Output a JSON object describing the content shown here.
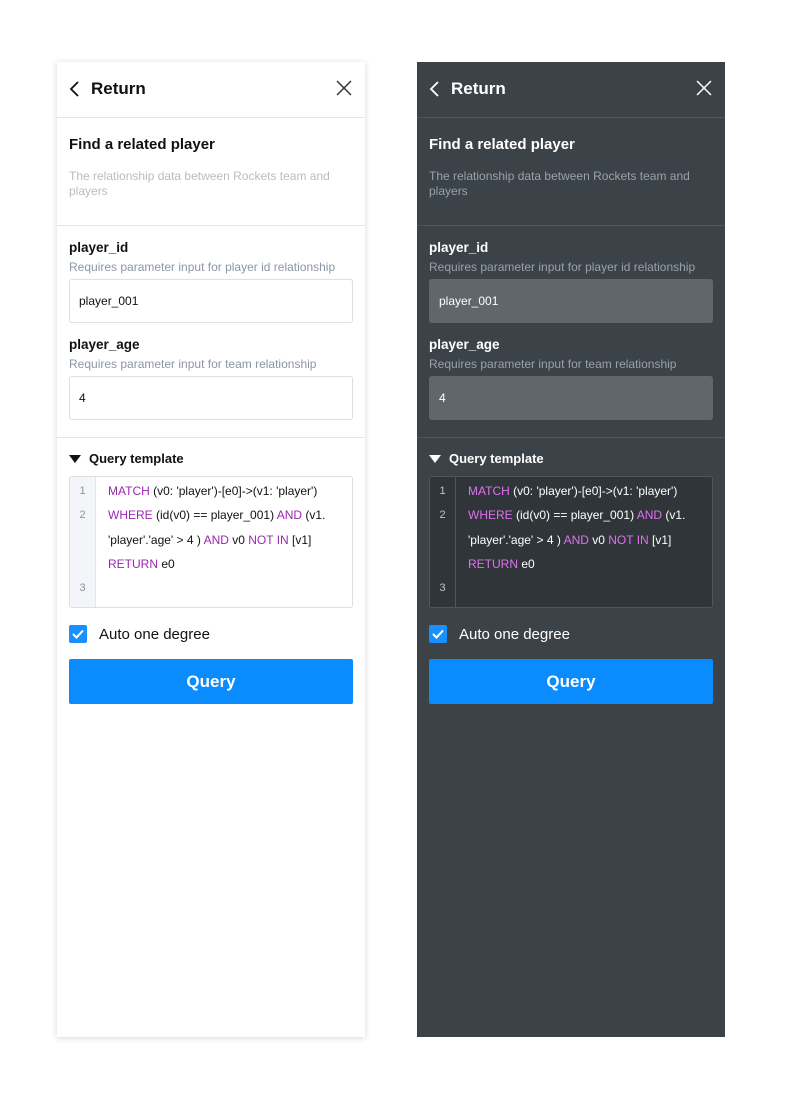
{
  "light": {
    "header": {
      "back_label": "Return"
    },
    "intro": {
      "title": "Find a related player",
      "description": "The relationship data between Rockets team and players"
    },
    "params": [
      {
        "label": "player_id",
        "hint": "Requires parameter input for player id relationship",
        "value": "player_001"
      },
      {
        "label": "player_age",
        "hint": "Requires parameter input for  team relationship",
        "value": "4"
      }
    ],
    "query_template": {
      "label": "Query template",
      "line_numbers": [
        "1",
        "2",
        "",
        "",
        "3"
      ],
      "lines": [
        [
          {
            "t": "MATCH",
            "kw": true
          },
          {
            "t": " (v0: 'player')-[e0]->(v1: 'player')",
            "kw": false
          }
        ],
        [
          {
            "t": "WHERE",
            "kw": true
          },
          {
            "t": " (id(v0) == player_001) ",
            "kw": false
          },
          {
            "t": "AND",
            "kw": true
          },
          {
            "t": " (v1.",
            "kw": false
          }
        ],
        [
          {
            "t": "'player'.'age' > 4 ) ",
            "kw": false
          },
          {
            "t": "AND",
            "kw": true
          },
          {
            "t": " v0 ",
            "kw": false
          },
          {
            "t": "NOT IN",
            "kw": true
          },
          {
            "t": " [v1]",
            "kw": false
          }
        ],
        [
          {
            "t": "RETURN",
            "kw": true
          },
          {
            "t": " e0",
            "kw": false
          }
        ],
        []
      ]
    },
    "auto_one_degree": {
      "label": "Auto one degree",
      "checked": true
    },
    "query_button": "Query"
  },
  "dark": {
    "header": {
      "back_label": "Return"
    },
    "intro": {
      "title": "Find a related player",
      "description": "The relationship data between Rockets team and players"
    },
    "params": [
      {
        "label": "player_id",
        "hint": "Requires parameter input for player id relationship",
        "value": "player_001"
      },
      {
        "label": "player_age",
        "hint": "Requires parameter input for  team relationship",
        "value": "4"
      }
    ],
    "query_template": {
      "label": "Query template",
      "line_numbers": [
        "1",
        "2",
        "",
        "",
        "3"
      ],
      "lines": [
        [
          {
            "t": "MATCH",
            "kw": true
          },
          {
            "t": " (v0: 'player')-[e0]->(v1: 'player')",
            "kw": false
          }
        ],
        [
          {
            "t": "WHERE",
            "kw": true
          },
          {
            "t": " (id(v0) == player_001) ",
            "kw": false
          },
          {
            "t": "AND",
            "kw": true
          },
          {
            "t": " (v1.",
            "kw": false
          }
        ],
        [
          {
            "t": "'player'.'age' > 4 ) ",
            "kw": false
          },
          {
            "t": "AND",
            "kw": true
          },
          {
            "t": " v0 ",
            "kw": false
          },
          {
            "t": "NOT IN",
            "kw": true
          },
          {
            "t": " [v1]",
            "kw": false
          }
        ],
        [
          {
            "t": "RETURN",
            "kw": true
          },
          {
            "t": " e0",
            "kw": false
          }
        ],
        []
      ]
    },
    "auto_one_degree": {
      "label": "Auto one degree",
      "checked": true
    },
    "query_button": "Query"
  },
  "colors": {
    "accent": "#0a8cff",
    "checkbox": "#1890ff",
    "keyword_light": "#9c27b0",
    "keyword_dark": "#de71ee",
    "dark_panel_bg": "#3b4248"
  }
}
